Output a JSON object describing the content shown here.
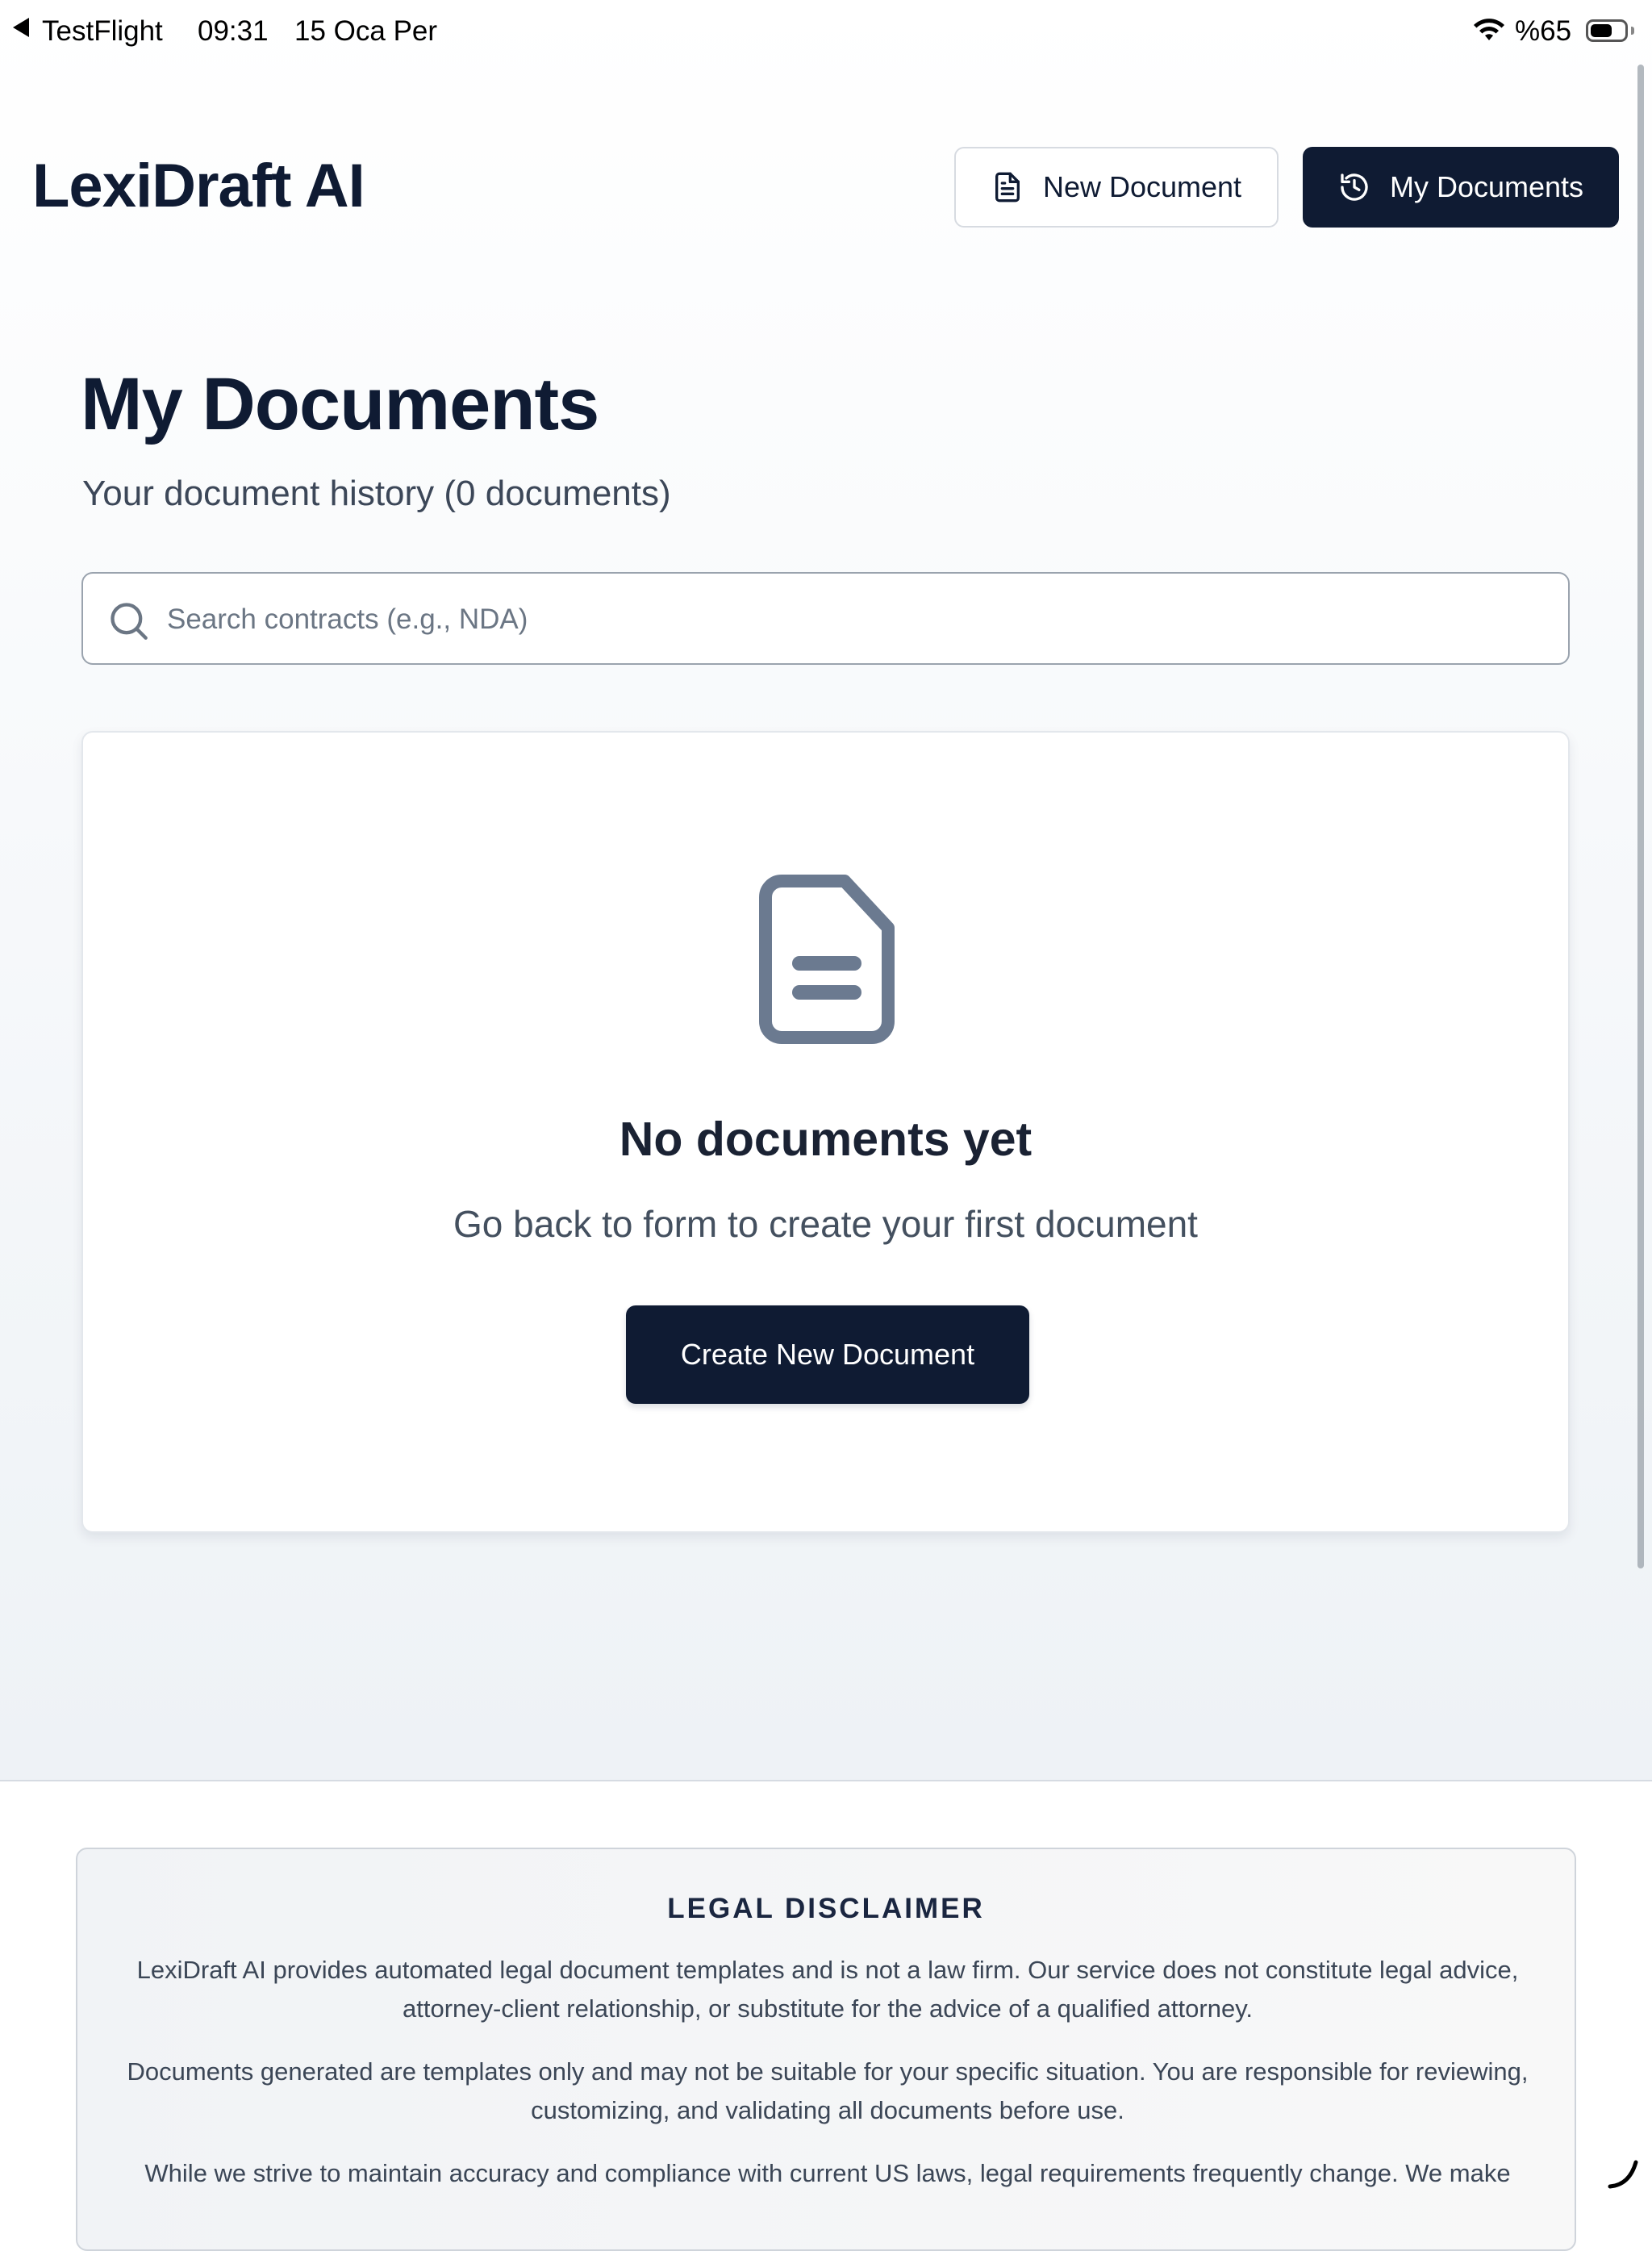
{
  "status_bar": {
    "back_app": "TestFlight",
    "time": "09:31",
    "date": "15 Oca Per",
    "battery_percent": "%65",
    "battery_level": 0.65
  },
  "header": {
    "app_title": "LexiDraft AI",
    "new_document_label": "New Document",
    "my_documents_label": "My Documents",
    "icons": {
      "new_document": "file-text-icon",
      "my_documents": "history-icon"
    }
  },
  "main": {
    "title": "My Documents",
    "subtitle": "Your document history (0 documents)",
    "search": {
      "placeholder": "Search contracts (e.g., NDA)",
      "value": ""
    },
    "empty_state": {
      "icon": "document-icon",
      "title": "No documents yet",
      "message": "Go back to form to create your first document",
      "button_label": "Create New Document"
    }
  },
  "footer": {
    "disclaimer_title": "LEGAL DISCLAIMER",
    "paragraphs": [
      "LexiDraft AI provides automated legal document templates and is not a law firm. Our service does not constitute legal advice, attorney-client relationship, or substitute for the advice of a qualified attorney.",
      "Documents generated are templates only and may not be suitable for your specific situation. You are responsible for reviewing, customizing, and validating all documents before use.",
      "While we strive to maintain accuracy and compliance with current US laws, legal requirements frequently change. We make"
    ]
  },
  "colors": {
    "primary": "#0f1b33",
    "border": "#d7dbe1",
    "text_muted": "#44505f",
    "icon_gray": "#6b7a90"
  }
}
